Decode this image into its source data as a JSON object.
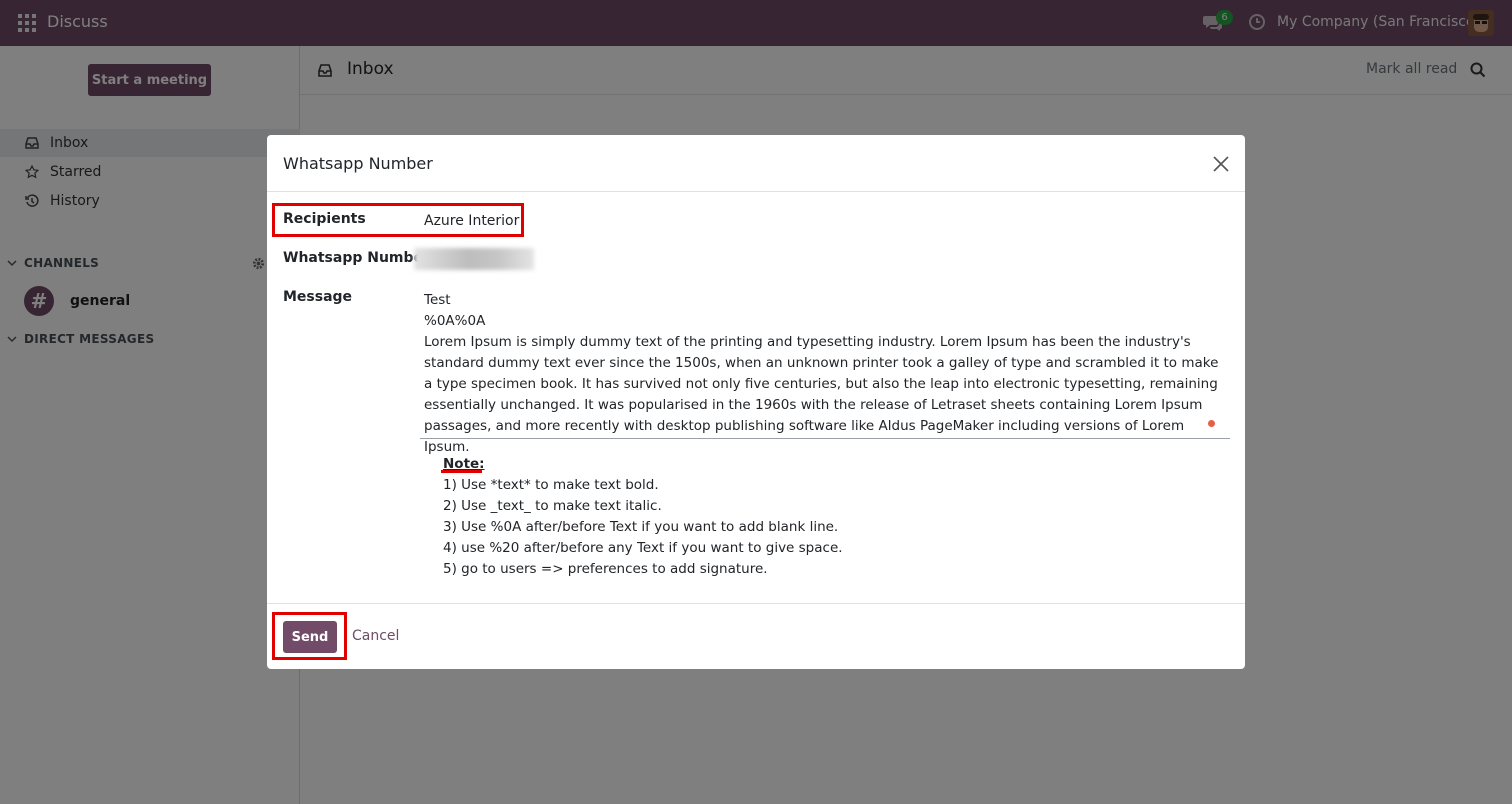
{
  "navbar": {
    "app_name": "Discuss",
    "message_count": "6",
    "company": "My Company (San Francisco)",
    "accent": "#714b67"
  },
  "sidebar": {
    "start_meeting": "Start a meeting",
    "items": [
      {
        "label": "Inbox",
        "icon": "inbox-icon"
      },
      {
        "label": "Starred",
        "icon": "star-icon"
      },
      {
        "label": "History",
        "icon": "history-icon"
      }
    ],
    "channels_header": "CHANNELS",
    "channels": [
      {
        "label": "general",
        "icon": "#"
      }
    ],
    "direct_header": "DIRECT MESSAGES"
  },
  "main": {
    "title": "Inbox",
    "mark_all_read": "Mark all read"
  },
  "modal": {
    "title": "Whatsapp Number",
    "recipients_label": "Recipients",
    "recipients_value": "Azure Interior",
    "number_label": "Whatsapp Number",
    "message_label": "Message",
    "message_value": "Test\n%0A%0A\nLorem Ipsum is simply dummy text of the printing and typesetting industry. Lorem Ipsum has been the industry's standard dummy text ever since the 1500s, when an unknown printer took a galley of type and scrambled it to make a type specimen book. It has survived not only five centuries, but also the leap into electronic typesetting, remaining essentially unchanged. It was popularised in the 1960s with the release of Letraset sheets containing Lorem Ipsum passages, and more recently with desktop publishing software like Aldus PageMaker including versions of Lorem Ipsum.",
    "note_title": "Note:",
    "notes": [
      "1) Use *text* to make text bold.",
      "2) Use _text_ to make text italic.",
      "3) Use %0A after/before Text if you want to add blank line.",
      "4) use %20 after/before any Text if you want to give space.",
      "5) go to users => preferences to add signature."
    ],
    "send_label": "Send",
    "cancel_label": "Cancel",
    "highlight_color": "#e00000"
  }
}
